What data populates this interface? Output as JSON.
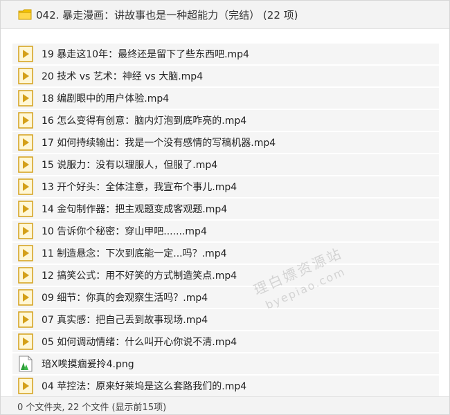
{
  "window": {
    "title": "042. 暴走漫画：讲故事也是一种超能力（完结）  (22 项)",
    "folder_icon": "folder-icon"
  },
  "files": [
    {
      "name": "19 暴走这10年：最终还是留下了些东西吧.mp4",
      "icon": "video-file-icon"
    },
    {
      "name": "20 技术 vs 艺术：神经 vs 大脑.mp4",
      "icon": "video-file-icon"
    },
    {
      "name": "18 编剧眼中的用户体验.mp4",
      "icon": "video-file-icon"
    },
    {
      "name": "16 怎么变得有创意：脑内灯泡到底咋亮的.mp4",
      "icon": "video-file-icon"
    },
    {
      "name": "17 如何持续输出：我是一个没有感情的写稿机器.mp4",
      "icon": "video-file-icon"
    },
    {
      "name": "15 说服力：没有以理服人，但服了.mp4",
      "icon": "video-file-icon"
    },
    {
      "name": "13 开个好头：全体注意，我宣布个事儿.mp4",
      "icon": "video-file-icon"
    },
    {
      "name": "14 金句制作器：把主观题变成客观题.mp4",
      "icon": "video-file-icon"
    },
    {
      "name": "10 告诉你个秘密：穿山甲吧.......mp4",
      "icon": "video-file-icon"
    },
    {
      "name": "11 制造悬念：下次到底能一定...吗？.mp4",
      "icon": "video-file-icon"
    },
    {
      "name": "12 搞笑公式：用不好笑的方式制造笑点.mp4",
      "icon": "video-file-icon"
    },
    {
      "name": "09 细节：你真的会观察生活吗？.mp4",
      "icon": "video-file-icon"
    },
    {
      "name": "07 真实感：把自己丢到故事现场.mp4",
      "icon": "video-file-icon"
    },
    {
      "name": "05 如何调动情绪：什么叫开心你说不清.mp4",
      "icon": "video-file-icon"
    },
    {
      "name": "琣X唉摸痼爰拎4.png",
      "icon": "image-file-icon"
    },
    {
      "name": "04 苹控法：原来好莱坞是这么套路我们的.mp4",
      "icon": "video-file-icon"
    }
  ],
  "status": {
    "text": "0 个文件夹, 22 个文件 (显示前15项)"
  },
  "watermark": {
    "line1": "理白嫖资源站",
    "line2": "byepiao.com"
  },
  "colors": {
    "video_icon": "#d4a019",
    "image_icon": "#2e9e3a",
    "folder_icon": "#f5c400"
  }
}
